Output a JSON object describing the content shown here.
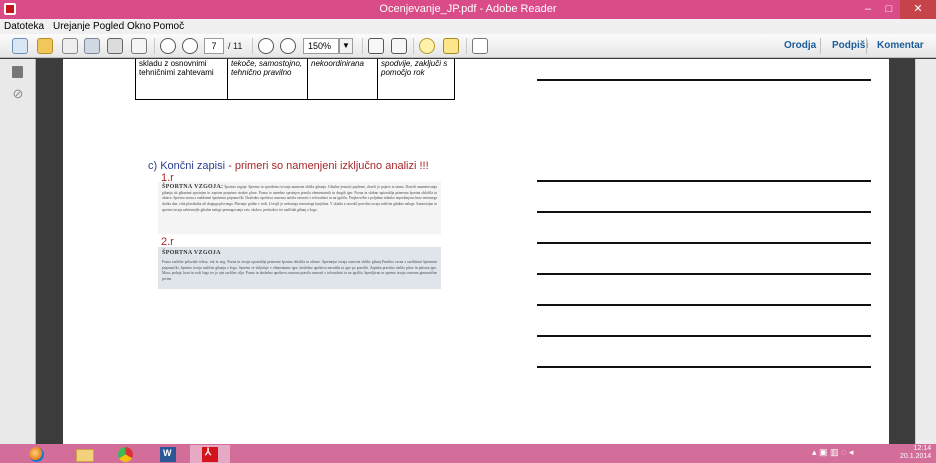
{
  "window": {
    "title": "Ocenjevanje_JP.pdf - Adobe Reader",
    "minimize": "–",
    "maximize": "□",
    "close": "✕"
  },
  "menu": [
    "Datoteka",
    "Urejanje",
    "Pogled",
    "Okno",
    "Pomoč"
  ],
  "toolbar": {
    "page_current": "7",
    "page_total": "/ 11",
    "zoom": "150%",
    "zoom_arrow": "▼",
    "right_tabs": [
      "Orodja",
      "Podpiši",
      "Komentar"
    ],
    "icons": [
      "create-pdf-icon",
      "combine-icon",
      "edit-icon",
      "save-icon",
      "print-icon",
      "email-icon",
      "page-up-icon",
      "page-down-icon",
      "zoom-out-icon",
      "zoom-in-icon",
      "fit-page-icon",
      "full-screen-icon",
      "comment-icon",
      "highlight-icon",
      "expand-icon"
    ]
  },
  "nav": {
    "pages_icon": "pages-icon",
    "attach_icon": "paperclip-icon",
    "attach_glyph": "⊘"
  },
  "document": {
    "table": {
      "c1": "skladu z osnovnimi tehničnimi zahtevami",
      "c2": "tekoče, samostojno, tehnično pravilno",
      "c3": "nekoordinirana",
      "c4": "spodvije, zaključi s pomočjo rok"
    },
    "heading_label": "c) Končni zapisi",
    "heading_red": " - primeri so namenjeni izključno analizi !!!",
    "sub1": "1.r",
    "sub2": "2.r",
    "scan1_title": "ŠPORTNA VZGOJA:",
    "scan1_text": "Športna vzgoja: Spremo in sprotšemo tovarja numerne oblike gibanja. Gibalne jesnosti pojdeme, doseči je pojave iz tanno. Dosedi onametovanja gibanja ob gibanimi sprotnjen in zapisne proprime strukte plose. Pozna to aznedno sprotnjen pravila elementarnih in drugih iger. Pozna in skrbno upiorablja primerna športna oblačila in obtave. Spretno ravna z razblaemi športnimi pripomočki. Dosledno upošteva osnovna načela varnosti v telovadnici in na igrišču. Preplava 8m s poljubno tehniko neprekinjeno brez vmesnega dotika dna, vrha plavalnika ali drugega plovnega. Plavanje gridne v vodi. Urvojil je uvdonega osnovnega kasjidina. V skladu z razvolil pravilno izvaja različne gibalne naloge. Samostojno in spretno izvaja zahtevnejše gibalne naloge premagovanja ovir, skokov, preskokov ter različnih gibanj z žogo.",
    "scan2_title": "ŠPORTNA VZGOJA",
    "scan2_text": "Pozna različne poloziale telesa, rok in nog. Pozna in izvaja upostablja primerna športna oblačila in obtave. Spretnejse izvaja osnovne oblike gibanj.Pravilno ravna z različnimi športnimi pripomočki. Spretno izvaja različne gibanja z žogo. Spretno se vključuje v elementarne igre, dosledno upošteva navodila in igre po pravilih. Zapiska pravilno oteklo plose in pilozoa igre. Mora, podaja, koni in vodi žogo ter jo ujet različne cilje. Pozna in dosledno upošteva osnovna pravila varnosti v telovadnici in na igrišču. Spretljivno in spretno izvaja osnovne gimnastične prvine."
  },
  "taskbar": {
    "apps": [
      "start-orb-icon",
      "explorer-icon",
      "chrome-icon",
      "word-icon",
      "adobe-reader-icon"
    ],
    "word_glyph": "W",
    "adobe_glyph": "⅄",
    "tray_glyphs": "▴  ▣  ▥  ◌  ◂",
    "time": "12:14",
    "date": "20.1.2014"
  }
}
